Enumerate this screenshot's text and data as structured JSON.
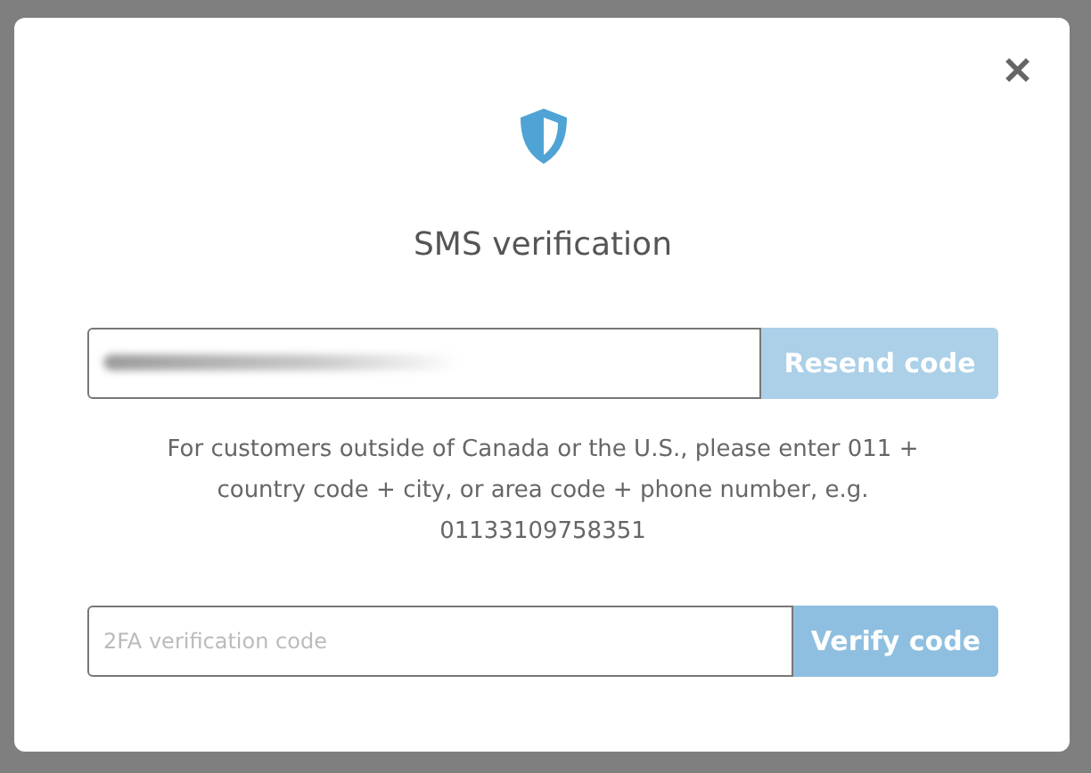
{
  "dialog": {
    "title": "SMS verification",
    "close_label": "✕"
  },
  "phone": {
    "value_blurred": true,
    "button": {
      "label": "Resend code",
      "disabled": true
    }
  },
  "help_text": "For customers outside of Canada or the U.S., please enter 011 + country code + city, or area code + phone number, e.g. 01133109758351",
  "code": {
    "placeholder": "2FA verification code",
    "button": {
      "label": "Verify code",
      "disabled": false
    }
  }
}
